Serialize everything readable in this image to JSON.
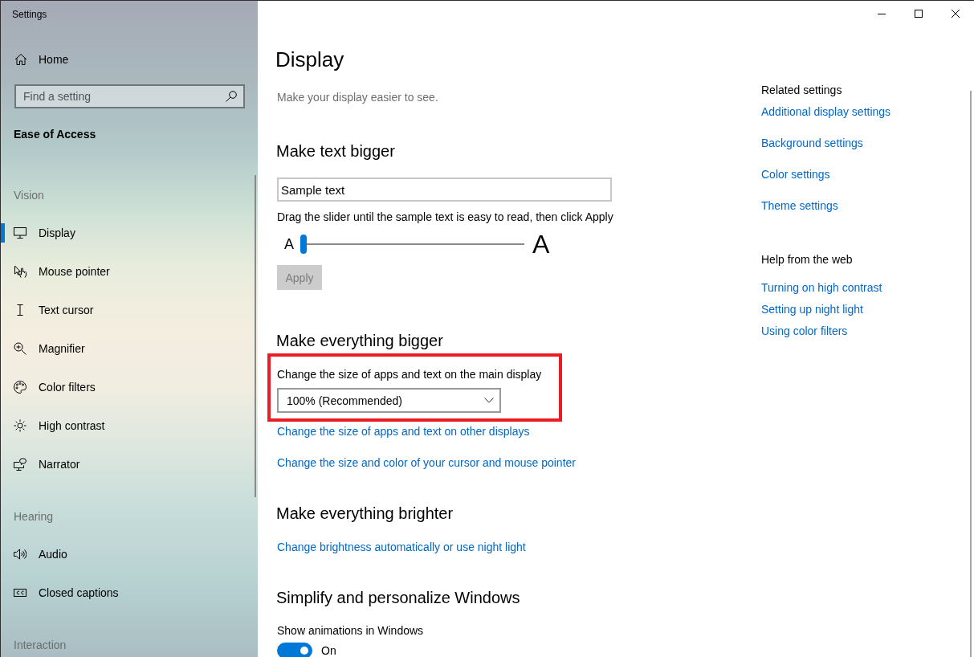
{
  "window": {
    "title": "Settings"
  },
  "sidebar": {
    "home": {
      "label": "Home"
    },
    "search": {
      "placeholder": "Find a setting"
    },
    "category": "Ease of Access",
    "groups": [
      {
        "heading": "Vision",
        "items": [
          {
            "label": "Display",
            "selected": true
          },
          {
            "label": "Mouse pointer",
            "selected": false
          },
          {
            "label": "Text cursor",
            "selected": false
          },
          {
            "label": "Magnifier",
            "selected": false
          },
          {
            "label": "Color filters",
            "selected": false
          },
          {
            "label": "High contrast",
            "selected": false
          },
          {
            "label": "Narrator",
            "selected": false
          }
        ]
      },
      {
        "heading": "Hearing",
        "items": [
          {
            "label": "Audio",
            "selected": false
          },
          {
            "label": "Closed captions",
            "selected": false
          }
        ]
      },
      {
        "heading": "Interaction"
      }
    ]
  },
  "page": {
    "title": "Display",
    "subtitle": "Make your display easier to see.",
    "sections": [
      {
        "heading": "Make text bigger",
        "items": [
          {
            "kind": "sample",
            "value": "Sample text"
          },
          {
            "kind": "hint",
            "text": "Drag the slider until the sample text is easy to read, then click Apply"
          },
          {
            "kind": "slider",
            "min_label": "A",
            "max_label": "A",
            "level": 0
          },
          {
            "kind": "button",
            "label": "Apply",
            "disabled": true
          }
        ]
      },
      {
        "heading": "Make everything bigger",
        "items": [
          {
            "kind": "dropdown",
            "label": "Change the size of apps and text on the main display",
            "value": "100% (Recommended)",
            "highlighted": true
          },
          {
            "kind": "link",
            "text": "Change the size of apps and text on other displays"
          },
          {
            "kind": "link",
            "text": "Change the size and color of your cursor and mouse pointer"
          }
        ]
      },
      {
        "heading": "Make everything brighter",
        "items": [
          {
            "kind": "link",
            "text": "Change brightness automatically or use night light"
          }
        ]
      },
      {
        "heading": "Simplify and personalize Windows",
        "items": [
          {
            "kind": "toggle",
            "label": "Show animations in Windows",
            "on": true,
            "state_label": "On"
          }
        ]
      }
    ]
  },
  "aside": {
    "related_settings": {
      "heading": "Related settings",
      "links": [
        "Additional display settings",
        "Background settings",
        "Color settings",
        "Theme settings"
      ]
    },
    "help_from_web": {
      "heading": "Help from the web",
      "links": [
        "Turning on high contrast",
        "Setting up night light",
        "Using color filters"
      ]
    }
  }
}
